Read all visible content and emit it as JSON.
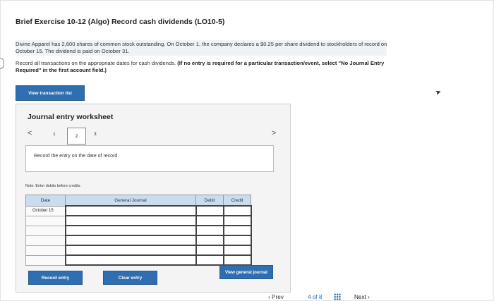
{
  "title": "Brief Exercise 10-12 (Algo) Record cash dividends (LO10-5)",
  "problem_text": "Divine Apparel has 2,600 shares of common stock outstanding. On October 1, the company declares a $0.25 per share dividend to stockholders of record on October 15. The dividend is paid on October 31.",
  "instruction_plain": "Record all transactions on the appropriate dates for cash dividends. ",
  "instruction_bold": "(If no entry is required for a particular transaction/event, select \"No Journal Entry Required\" in the first account field.)",
  "view_transaction_list": "View transaction list",
  "worksheet": {
    "title": "Journal entry worksheet",
    "prev_glyph": "<",
    "next_glyph": ">",
    "pages": [
      "1",
      "2",
      "3"
    ],
    "current_page": "2",
    "instruction": "Record the entry on the date of record.",
    "note": "Note: Enter debits before credits.",
    "table": {
      "headers": [
        "Date",
        "General Journal",
        "Debit",
        "Credit"
      ],
      "rows": [
        [
          "October 15",
          "",
          "",
          ""
        ],
        [
          "",
          "",
          "",
          ""
        ],
        [
          "",
          "",
          "",
          ""
        ],
        [
          "",
          "",
          "",
          ""
        ],
        [
          "",
          "",
          "",
          ""
        ],
        [
          "",
          "",
          "",
          ""
        ]
      ]
    },
    "record_entry": "Record entry",
    "clear_entry": "Clear entry",
    "view_general_journal": "View general journal"
  },
  "bottom_nav": {
    "prev": "‹  Prev",
    "page_count": "4 of 8",
    "next": "Next  ›"
  },
  "colors": {
    "accent": "#2f6eb0",
    "table_header": "#c9dcf0",
    "highlight": "#eef3f8"
  }
}
